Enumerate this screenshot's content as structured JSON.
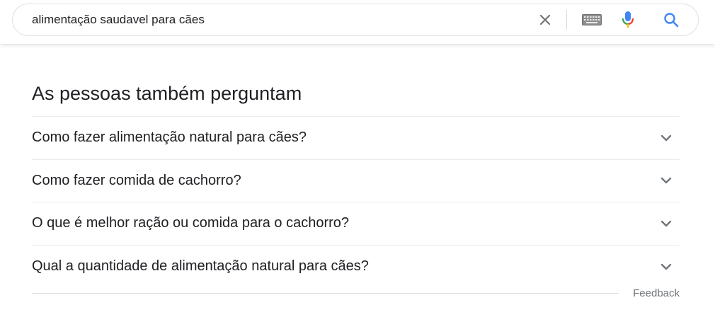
{
  "search": {
    "query": "alimentação saudavel para cães"
  },
  "icons": {
    "clear": "close-icon",
    "keyboard": "keyboard-icon",
    "voice": "microphone-icon",
    "search": "search-icon",
    "expand": "chevron-down-icon"
  },
  "colors": {
    "mic_blue": "#4285f4",
    "mic_red": "#ea4335",
    "mic_yellow": "#fbbc05",
    "mic_green": "#34a853",
    "search_blue": "#4285f4"
  },
  "people_also_ask": {
    "title": "As pessoas também perguntam",
    "questions": [
      "Como fazer alimentação natural para cães?",
      "Como fazer comida de cachorro?",
      "O que é melhor ração ou comida para o cachorro?",
      "Qual a quantidade de alimentação natural para cães?"
    ]
  },
  "feedback": {
    "label": "Feedback"
  }
}
